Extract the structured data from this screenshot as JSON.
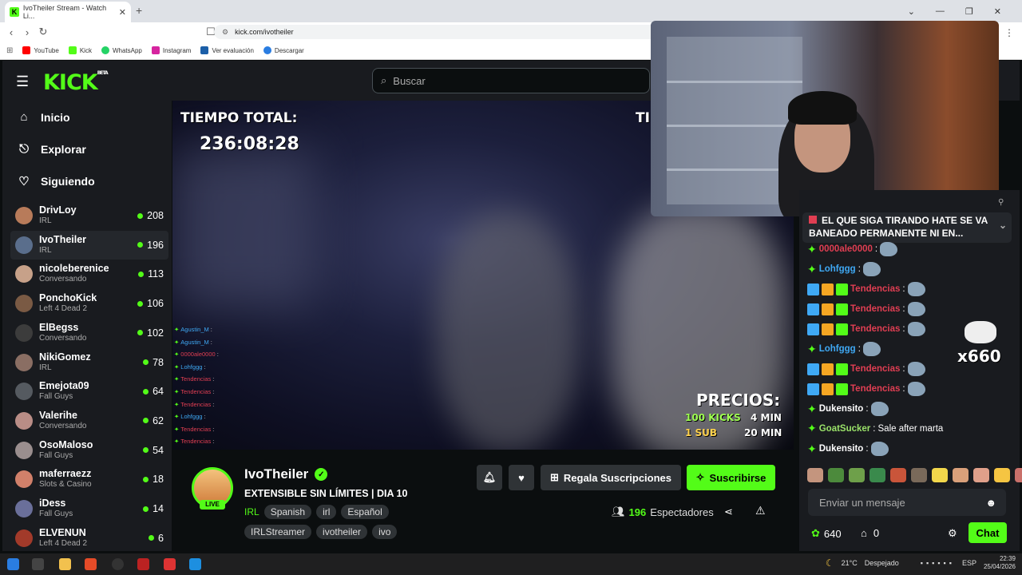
{
  "browser": {
    "tab_title": "IvoTheiler Stream - Watch Li...",
    "url": "kick.com/ivotheiler",
    "bookmarks": [
      "YouTube",
      "Kick",
      "WhatsApp",
      "Instagram",
      "Ver evaluación",
      "Descargar"
    ]
  },
  "header": {
    "logo": "KICK",
    "logo_badge": "BETA",
    "search_placeholder": "Buscar"
  },
  "sidebar": {
    "nav": [
      "Inicio",
      "Explorar",
      "Siguiendo"
    ],
    "channels": [
      {
        "name": "DrivLoy",
        "category": "IRL",
        "viewers": "208",
        "color": "#b87b5a"
      },
      {
        "name": "IvoTheiler",
        "category": "IRL",
        "viewers": "196",
        "color": "#5a6e8c"
      },
      {
        "name": "nicoleberenice",
        "category": "Conversando",
        "viewers": "113",
        "color": "#c7a189"
      },
      {
        "name": "PonchoKick",
        "category": "Left 4 Dead 2",
        "viewers": "106",
        "color": "#7a5a44"
      },
      {
        "name": "ElBegss",
        "category": "Conversando",
        "viewers": "102",
        "color": "#3c3c3c"
      },
      {
        "name": "NikiGomez",
        "category": "IRL",
        "viewers": "78",
        "color": "#8a6e63"
      },
      {
        "name": "Emejota09",
        "category": "Fall Guys",
        "viewers": "64",
        "color": "#555a60"
      },
      {
        "name": "Valerihe",
        "category": "Conversando",
        "viewers": "62",
        "color": "#b98d86"
      },
      {
        "name": "OsoMaloso",
        "category": "Fall Guys",
        "viewers": "54",
        "color": "#9a8e8e"
      },
      {
        "name": "maferraezz",
        "category": "Slots & Casino",
        "viewers": "18",
        "color": "#d1806a"
      },
      {
        "name": "iDess",
        "category": "Fall Guys",
        "viewers": "14",
        "color": "#6a6f9a"
      },
      {
        "name": "ELVENUN",
        "category": "Left 4 Dead 2",
        "viewers": "6",
        "color": "#a23a2a"
      }
    ]
  },
  "video": {
    "timer_label": "TIEMPO TOTAL:",
    "timer_value": "236:08:28",
    "prices_label": "PRECIOS:",
    "prices": [
      {
        "left": "100 KICKS",
        "right": "4 MIN"
      },
      {
        "left": "1 SUB",
        "right": "20 MIN"
      }
    ],
    "overlay_chat": [
      {
        "user": "Agustin_M",
        "color": "#3fa9f5"
      },
      {
        "user": "Agustin_M",
        "color": "#3fa9f5"
      },
      {
        "user": "0000ale0000",
        "color": "#e03e52"
      },
      {
        "user": "Lohfggg",
        "color": "#3fa9f5"
      },
      {
        "user": "Tendencias",
        "color": "#e03e52"
      },
      {
        "user": "Tendencias",
        "color": "#e03e52"
      },
      {
        "user": "Tendencias",
        "color": "#e03e52"
      },
      {
        "user": "Lohfggg",
        "color": "#3fa9f5"
      },
      {
        "user": "Tendencias",
        "color": "#e03e52"
      },
      {
        "user": "Tendencias",
        "color": "#e03e52"
      }
    ]
  },
  "stream": {
    "name": "IvoTheiler",
    "live": "LIVE",
    "title": "EXTENSIBLE SIN LÍMITES | DIA 10",
    "category": "IRL",
    "tags1": [
      "Spanish",
      "irl",
      "Español"
    ],
    "tags2": [
      "IRLStreamer",
      "ivotheiler",
      "ivo"
    ],
    "gift_label": "Regala Suscripciones",
    "subscribe_label": "Suscribirse",
    "viewers_count": "196",
    "viewers_label": "Espectadores"
  },
  "chat": {
    "pinned": "EL QUE SIGA TIRANDO HATE SE VA BANEADO PERMANENTE NI EN...",
    "messages": [
      {
        "user": "0000ale0000",
        "color": "#e03e52",
        "text": "",
        "badges": 1
      },
      {
        "user": "Lohfggg",
        "color": "#3fa9f5",
        "text": "",
        "badges": 1
      },
      {
        "user": "Tendencias",
        "color": "#e03e52",
        "text": "",
        "badges": 3
      },
      {
        "user": "Tendencias",
        "color": "#e03e52",
        "text": "",
        "badges": 3
      },
      {
        "user": "Tendencias",
        "color": "#e03e52",
        "text": "",
        "badges": 3
      },
      {
        "user": "Lohfggg",
        "color": "#3fa9f5",
        "text": "",
        "badges": 1
      },
      {
        "user": "Tendencias",
        "color": "#e03e52",
        "text": "",
        "badges": 3
      },
      {
        "user": "Tendencias",
        "color": "#e03e52",
        "text": "",
        "badges": 3
      },
      {
        "user": "Dukensito",
        "color": "#ffffff",
        "text": "",
        "badges": 1
      },
      {
        "user": "GoatSucker",
        "color": "#9be36a",
        "text": "Sale after marta",
        "badges": 1
      },
      {
        "user": "Dukensito",
        "color": "#ffffff",
        "text": "",
        "badges": 1
      }
    ],
    "combo": "x660",
    "input_placeholder": "Enviar un mensaje",
    "kicks": "640",
    "items": "0",
    "chat_button": "Chat"
  },
  "taskbar": {
    "weather": "21°C",
    "weather_desc": "Despejado",
    "lang": "ESP",
    "time": "22:39",
    "date": "25/04/2026"
  }
}
